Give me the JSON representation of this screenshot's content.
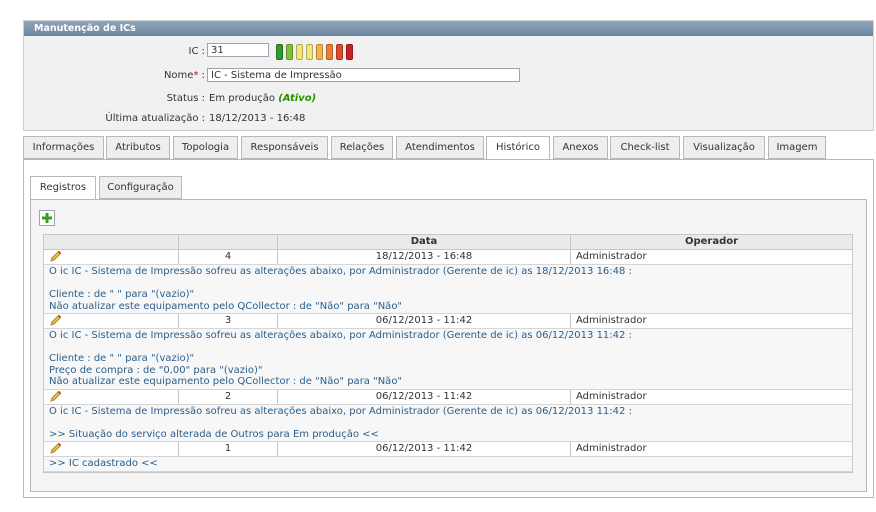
{
  "panel": {
    "title": "Manutenção de ICs",
    "ic_label": "IC :",
    "ic_value": "31",
    "nome_label": "Nome",
    "nome_suffix": ":",
    "nome_value": "IC - Sistema de Impressão",
    "status_label": "Status :",
    "status_value": "Em produção",
    "status_badge": "(Ativo)",
    "update_label": "Última atualização :",
    "update_value": "18/12/2013 - 16:48",
    "leds": [
      "#2f9a2f",
      "#7fc233",
      "#f3e57a",
      "#f3e57a",
      "#f4b04a",
      "#ef7d2e",
      "#e04a2b",
      "#cc1f1f"
    ]
  },
  "tabs": [
    "Informações",
    "Atributos",
    "Topologia",
    "Responsáveis",
    "Relações",
    "Atendimentos",
    "Histórico",
    "Anexos",
    "Check-list",
    "Visualização",
    "Imagem"
  ],
  "active_tab": "Histórico",
  "subtabs": [
    "Registros",
    "Configuração"
  ],
  "grid": {
    "headers": [
      "",
      "",
      "Data",
      "Operador"
    ],
    "records": [
      {
        "num": "4",
        "date": "18/12/2013 - 16:48",
        "operator": "Administrador",
        "lines": [
          "O ic IC - Sistema de Impressão sofreu as alterações abaixo, por Administrador (Gerente de ic) as 18/12/2013 16:48 :",
          "",
          "Cliente : de \" \" para \"(vazio)\"",
          "Não atualizar este equipamento pelo QCollector : de \"Não\" para \"Não\""
        ]
      },
      {
        "num": "3",
        "date": "06/12/2013 - 11:42",
        "operator": "Administrador",
        "lines": [
          "O ic IC - Sistema de Impressão sofreu as alterações abaixo, por Administrador (Gerente de ic) as 06/12/2013 11:42 :",
          "",
          "Cliente : de \" \" para \"(vazio)\"",
          "Preço de compra : de \"0,00\" para \"(vazio)\"",
          "Não atualizar este equipamento pelo QCollector : de \"Não\" para \"Não\""
        ]
      },
      {
        "num": "2",
        "date": "06/12/2013 - 11:42",
        "operator": "Administrador",
        "lines": [
          "O ic IC - Sistema de Impressão sofreu as alterações abaixo, por Administrador (Gerente de ic) as 06/12/2013 11:42 :",
          "",
          ">> Situação do serviço alterada de Outros para Em produção <<"
        ]
      },
      {
        "num": "1",
        "date": "06/12/2013 - 11:42",
        "operator": "Administrador",
        "lines": [
          ">> IC cadastrado <<"
        ]
      }
    ]
  }
}
